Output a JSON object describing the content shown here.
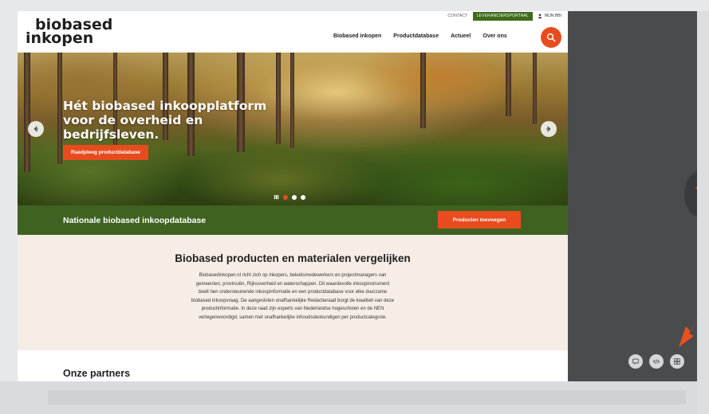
{
  "header": {
    "logo_line1": "biobased",
    "logo_line2": "inkopen",
    "util_nav": {
      "contact": "CONTACT",
      "portal": "LEVERANCIERSPORTAAL",
      "account": "MIJN BBI"
    },
    "main_nav": [
      "Biobased inkopen",
      "Productdatabase",
      "Actueel",
      "Over ons"
    ]
  },
  "hero": {
    "title_lines": [
      "Hét biobased inkoopplatform",
      "voor de overheid en",
      "bedrijfsleven."
    ],
    "button_label": "Raadpleeg productdatabase",
    "slide_count": 3,
    "active_slide": 1
  },
  "green_bar": {
    "title": "Nationale biobased inkoopdatabase",
    "button_label": "Producten toevoegen"
  },
  "intro": {
    "title": "Biobased producten en materialen vergelijken",
    "body_lines": [
      "Biobasedinkopen.nl richt zich op inkopers, beleidsmedewerkers en projectmanagers van",
      "gemeenten, provinciën, Rijksoverheid en waterschappen. Dit waardevolle inkoopinstrument",
      "biedt hen ondersteunende inkoopinformatie en een productdatabase voor elke duurzame",
      "biobased inkoopvraag. De aangesloten onafhankelijke Redactieraad borgt de kwaliteit van deze",
      "productinformatie. In deze raad zijn experts van Nederlandse hogescholen en de NEN",
      "vertegenwoordigd, samen met onafhankelijke inhoudsdeskundigen per productcategorie."
    ]
  },
  "partners": {
    "title": "Onze partners"
  },
  "colors": {
    "accent": "#e84c1e",
    "green": "#3e6b1b",
    "intro_bg": "#f6ede6",
    "panel": "#4a4b4d"
  },
  "icons": [
    "search-icon",
    "user-icon",
    "arrow-left-icon",
    "arrow-right-icon",
    "pause-icon",
    "comment-icon",
    "code-icon",
    "grid-icon"
  ]
}
